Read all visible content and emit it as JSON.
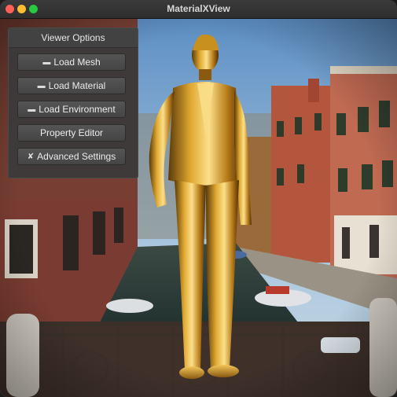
{
  "window": {
    "title": "MaterialXView"
  },
  "panel": {
    "header": "Viewer Options",
    "buttons": [
      {
        "label": "Load Mesh",
        "icon": "folder-icon"
      },
      {
        "label": "Load Material",
        "icon": "folder-icon"
      },
      {
        "label": "Load Environment",
        "icon": "folder-icon"
      },
      {
        "label": "Property Editor",
        "icon": ""
      },
      {
        "label": "Advanced Settings",
        "icon": "wrench-icon"
      }
    ]
  },
  "colors": {
    "close": "#ff5f57",
    "minimize": "#febc2e",
    "maximize": "#28c840",
    "gold": "#c8901e"
  }
}
